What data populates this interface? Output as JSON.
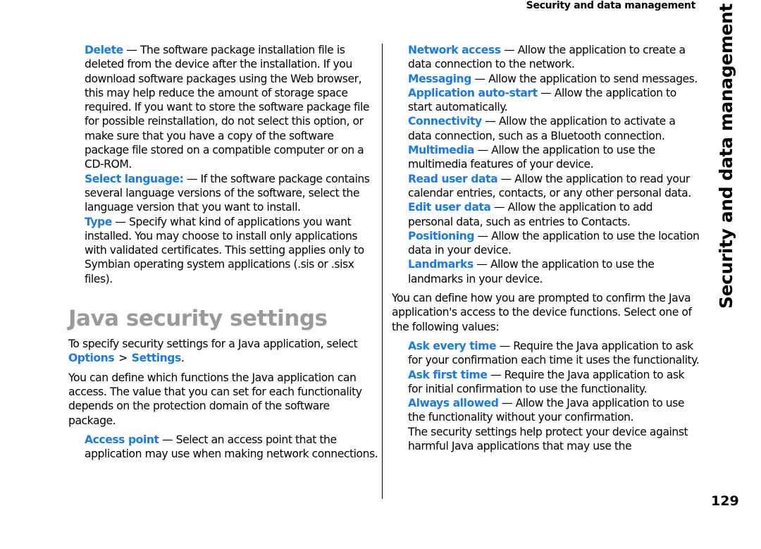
{
  "header": {
    "running_title": "Security and data management"
  },
  "side_title": "Security and data management",
  "page_number": "129",
  "colors": {
    "term": "#1a7be8",
    "heading": "#9a9a9a",
    "text": "#000000"
  },
  "left_column": {
    "install_options": [
      {
        "term": "Delete",
        "desc": " — The software package installation file is deleted from the device after the installation. If you download software packages using the Web browser, this may help reduce the amount of storage space required. If you want to store the software package file for possible reinstallation, do not select this option, or make sure that you have a copy of the software package file stored on a compatible computer or on a CD-ROM."
      },
      {
        "term": "Select language:",
        "desc": " — If the software package contains several language versions of the software, select the language version that you want to install."
      },
      {
        "term": "Type",
        "desc": " — Specify what kind of applications you want installed. You may choose to install only applications with validated certificates. This setting applies only to Symbian operating system applications (.sis or .sisx files)."
      }
    ],
    "section_heading": "Java security settings",
    "intro_text": "To specify security settings for a Java application, select",
    "menu_path": {
      "first": "Options",
      "separator": ">",
      "second": "Settings",
      "end": "."
    },
    "functions_text": "You can define which functions the Java application can access. The value that you can set for each functionality depends on the protection domain of the software package.",
    "access_point": {
      "term": "Access point",
      "desc": " — Select an access point that the application may use when making network connections."
    }
  },
  "right_column": {
    "functions": [
      {
        "term": "Network access",
        "desc": " — Allow the application to create a data connection to the network."
      },
      {
        "term": "Messaging",
        "desc": " — Allow the application to send messages."
      },
      {
        "term": "Application auto-start",
        "desc": " — Allow the application to start automatically."
      },
      {
        "term": "Connectivity",
        "desc": " — Allow the application to activate a data connection, such as a Bluetooth connection."
      },
      {
        "term": "Multimedia",
        "desc": " — Allow the application to use the multimedia features of your device."
      },
      {
        "term": "Read user data",
        "desc": " — Allow the application to read your calendar entries, contacts, or any other personal data."
      },
      {
        "term": "Edit user data",
        "desc": " — Allow the application to add personal data, such as entries to Contacts."
      },
      {
        "term": "Positioning",
        "desc": " — Allow the application to use the location data in your device."
      },
      {
        "term": "Landmarks",
        "desc": " — Allow the application to use the landmarks in your device."
      }
    ],
    "prompt_text": "You can define how you are prompted to confirm the Java application's access to the device functions. Select one of the following values:",
    "values": [
      {
        "term": "Ask every time",
        "desc": " — Require the Java application to ask for your confirmation each time it uses the functionality."
      },
      {
        "term": "Ask first time",
        "desc": " — Require the Java application to ask for initial confirmation to use the functionality."
      },
      {
        "term": "Always allowed",
        "desc": " — Allow the Java application to use the functionality without your confirmation."
      }
    ],
    "closing_text": "The security settings help protect your device against harmful Java applications that may use the"
  }
}
